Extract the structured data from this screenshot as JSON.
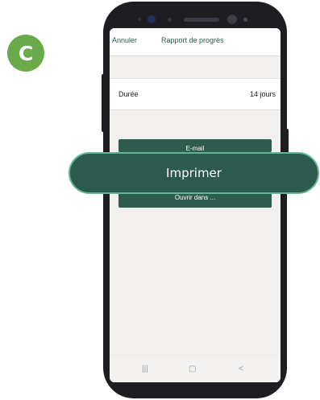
{
  "step_badge": "C",
  "nav": {
    "cancel_label": "Annuler",
    "title": "Rapport de progrès"
  },
  "duration_row": {
    "label": "Durée",
    "value": "14 jours"
  },
  "share_sheet": {
    "email_label": "E-mail",
    "print_label": "Imprimer",
    "open_in_label": "Ouvrir dans ..."
  },
  "system_nav": {
    "recents_glyph": "|||",
    "home_glyph": "▢",
    "back_glyph": "<"
  },
  "colors": {
    "badge": "#6aaa4a",
    "button": "#2e5c4f",
    "callout_border": "#5fb893",
    "accent_text": "#2b5a4a"
  }
}
